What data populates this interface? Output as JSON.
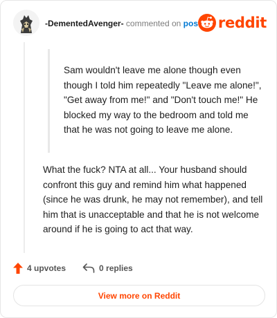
{
  "header": {
    "author": "-DementedAvenger-",
    "commented_text": "commented on",
    "post_link": "post",
    "brand": "reddit"
  },
  "comment": {
    "quote": "Sam wouldn't leave me alone though even though I told him repeatedly \"Leave me alone!\", \"Get away from me!\" and \"Don't touch me!\" He blocked my way to the bedroom and told me that he was not going to leave me alone.",
    "body": "What the fuck? NTA at all... Your husband should confront this guy and remind him what happened (since he was drunk, he may not remember), and tell him that is unacceptable and that he is not welcome around if he is going to act that way."
  },
  "actions": {
    "upvotes": "4 upvotes",
    "replies": "0 replies"
  },
  "view_more": "View more on Reddit",
  "colors": {
    "brand": "#ff4500",
    "link": "#0079d3"
  },
  "icons": {
    "avatar": "avatar",
    "logo": "reddit-snoo-icon",
    "upvote": "upvote-arrow-icon",
    "reply": "reply-arrow-icon"
  }
}
